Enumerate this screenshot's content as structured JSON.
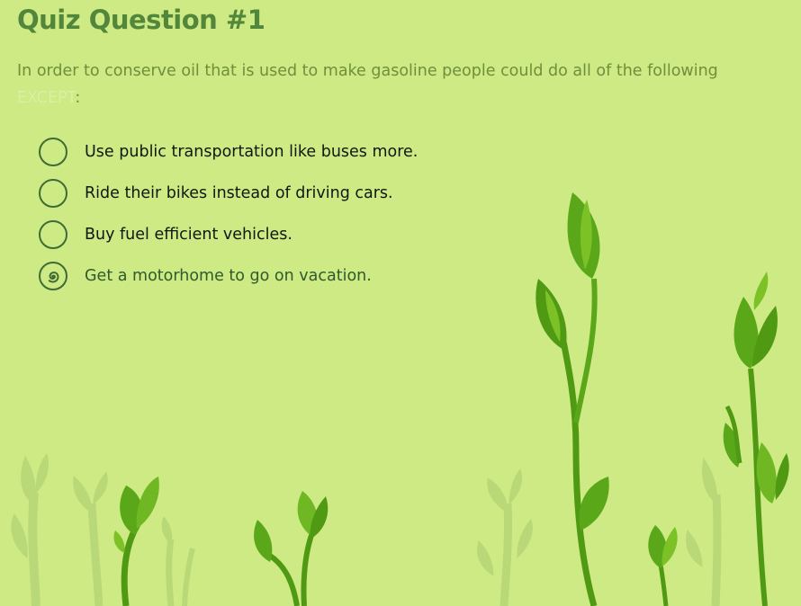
{
  "quiz": {
    "title": "Quiz Question #1",
    "question_text": "In order to conserve oil that is used to make gasoline people could do all of the following ",
    "question_highlight": "EXCEPT",
    "question_end": ":",
    "options": [
      {
        "label": "Use public transportation like buses more.",
        "selected": false
      },
      {
        "label": "Ride their bikes instead of driving cars.",
        "selected": false
      },
      {
        "label": "Buy fuel efficient vehicles.",
        "selected": false
      },
      {
        "label": "Get a motorhome to go on vacation.",
        "selected": true
      }
    ]
  },
  "colors": {
    "background": "#cdea84",
    "title": "#52863a",
    "question": "#6f8f3c",
    "leaf_dark": "#4f9a12",
    "leaf_light": "#7cc227",
    "sprout_faded": "#b9d878"
  },
  "icons": {
    "radio_selected": "spiral-radio-icon",
    "decoration": "sprout-leaves"
  }
}
